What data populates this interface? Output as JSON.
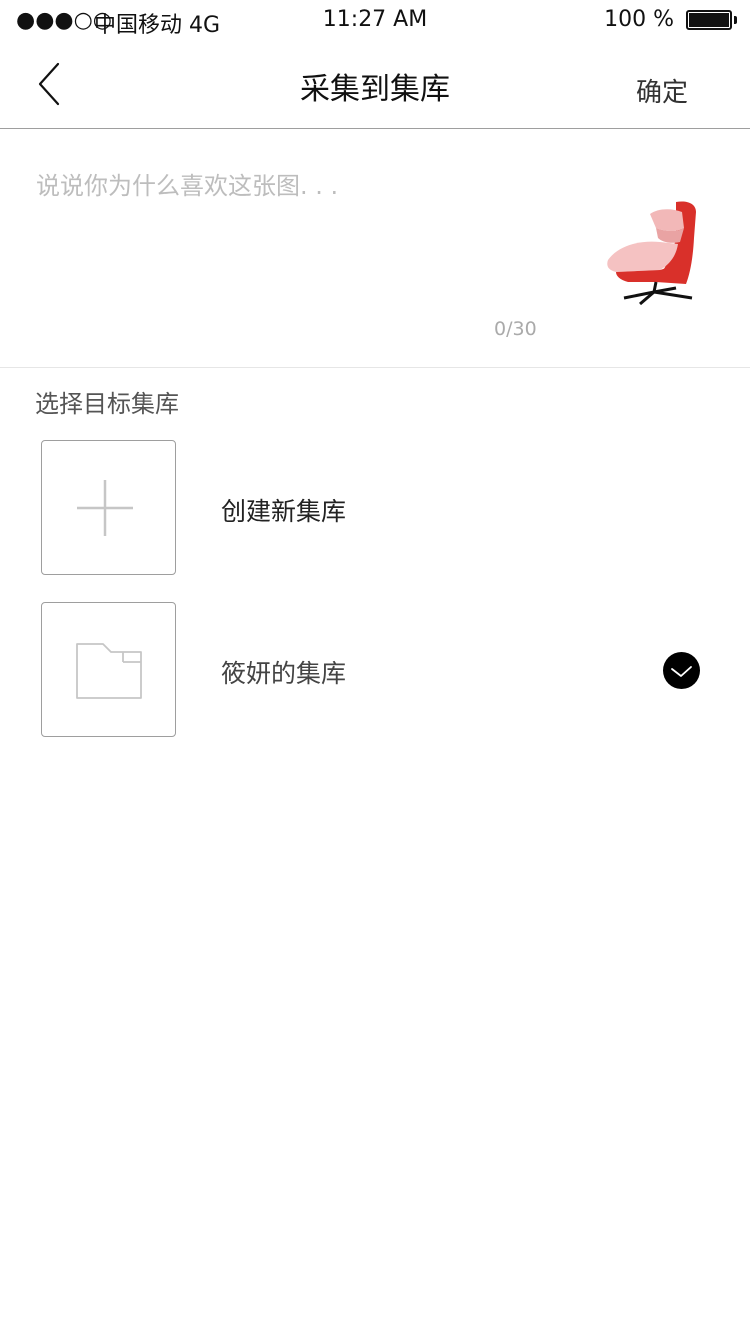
{
  "status_bar": {
    "signal": "●●●○○",
    "carrier": "中国移动 4G",
    "time": "11:27 AM",
    "battery": "100 %"
  },
  "nav": {
    "back_icon": "chevron-left-icon",
    "title": "采集到集库",
    "confirm_label": "确定"
  },
  "comment": {
    "placeholder": "说说你为什么喜欢这张图. . .",
    "value": "",
    "counter": "0/30"
  },
  "section": {
    "title": "选择目标集库"
  },
  "collections": [
    {
      "label": "创建新集库",
      "icon": "plus-icon",
      "selected": false
    },
    {
      "label": "筱妍的集库",
      "icon": "folder-icon",
      "selected": true
    }
  ],
  "colors": {
    "divider": "#9e9e9e",
    "placeholder": "#bdbdbd",
    "chair_red": "#d9302a",
    "chair_pink": "#f2b8b8",
    "check_bg": "#000000"
  }
}
